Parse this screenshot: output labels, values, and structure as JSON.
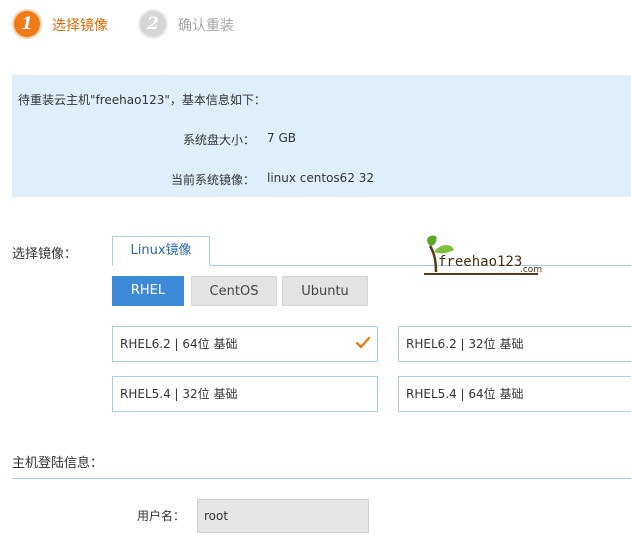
{
  "steps": [
    {
      "number": "1",
      "label": "选择镜像"
    },
    {
      "number": "2",
      "label": "确认重装"
    }
  ],
  "info": {
    "intro": "待重装云主机\"freehao123\"，基本信息如下：",
    "rows": [
      {
        "key": "系统盘大小：",
        "value": "7 GB"
      },
      {
        "key": "当前系统镜像：",
        "value": "linux centos62 32"
      }
    ]
  },
  "image_section": {
    "label": "选择镜像：",
    "tab": "Linux镜像",
    "os_buttons": [
      "RHEL",
      "CentOS",
      "Ubuntu"
    ],
    "selected_os": "RHEL",
    "images": [
      {
        "label": "RHEL6.2 | 64位 基础",
        "selected": true
      },
      {
        "label": "RHEL6.2 | 32位 基础",
        "selected": false
      },
      {
        "label": "RHEL5.4 | 32位 基础",
        "selected": false
      },
      {
        "label": "RHEL5.4 | 64位 基础",
        "selected": false
      }
    ]
  },
  "login_section": {
    "label": "主机登陆信息：",
    "username_label": "用户名：",
    "username_value": "root"
  },
  "logo": {
    "text": "freehao123",
    "suffix": ".com"
  },
  "colors": {
    "accent": "#f07a18",
    "primary": "#3d8bd6",
    "panel": "#ddeffa",
    "border": "#a9cfe6"
  }
}
